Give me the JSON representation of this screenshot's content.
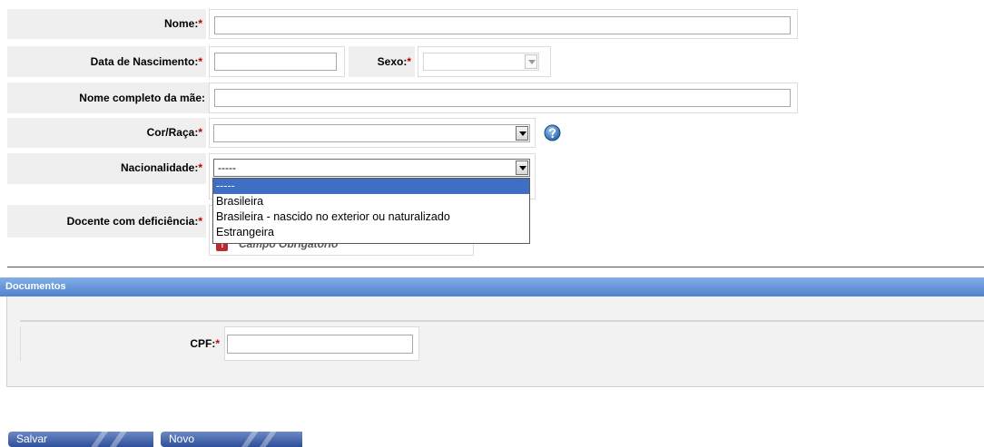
{
  "form": {
    "nome": {
      "label": "Nome:",
      "required": "*",
      "value": ""
    },
    "data_nascimento": {
      "label": "Data de Nascimento:",
      "required": "*",
      "value": ""
    },
    "sexo": {
      "label": "Sexo:",
      "required": "*",
      "value": ""
    },
    "nome_mae": {
      "label": "Nome completo da mãe:",
      "value": ""
    },
    "cor_raca": {
      "label": "Cor/Raça:",
      "required": "*",
      "value": ""
    },
    "nacionalidade": {
      "label": "Nacionalidade:",
      "required": "*",
      "value": "-----",
      "options": [
        "-----",
        "Brasileira",
        "Brasileira - nascido no exterior ou naturalizado",
        "Estrangeira"
      ]
    },
    "docente_deficiencia": {
      "label": "Docente com deficiência:",
      "required": "*"
    },
    "required_note": "* Campo Obrigatório"
  },
  "documentos": {
    "title": "Documentos",
    "cpf": {
      "label": "CPF:",
      "required": "*",
      "value": ""
    }
  },
  "buttons": {
    "salvar": "Salvar",
    "novo": "Novo"
  },
  "icons": {
    "help": "help-icon",
    "warning": "warning-icon"
  },
  "colors": {
    "required": "#c00000",
    "section": "#4f83cc",
    "selected_option": "#3f6ec4"
  }
}
